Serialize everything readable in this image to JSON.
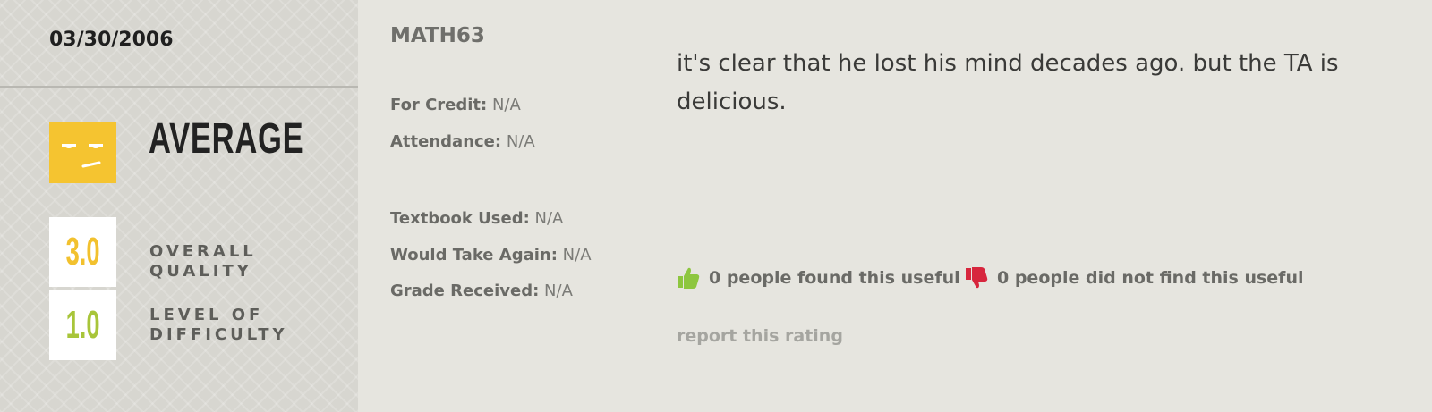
{
  "rating": {
    "date": "03/30/2006",
    "mood": "AVERAGE",
    "mood_icon": "meh-face-icon",
    "mood_color": "#f5c430",
    "scores": {
      "overall_quality": {
        "value": "3.0",
        "label": "OVERALL QUALITY",
        "color": "#f2c12e"
      },
      "level_of_difficulty": {
        "value": "1.0",
        "label": "LEVEL OF DIFFICULTY",
        "color": "#a8c53a"
      }
    }
  },
  "class_info": {
    "course": "MATH63",
    "for_credit_label": "For Credit:",
    "for_credit_value": "N/A",
    "attendance_label": "Attendance:",
    "attendance_value": "N/A",
    "textbook_label": "Textbook Used:",
    "textbook_value": "N/A",
    "take_again_label": "Would Take Again:",
    "take_again_value": "N/A",
    "grade_label": "Grade Received:",
    "grade_value": "N/A"
  },
  "comment": {
    "text": "it's clear that he lost his mind decades ago. but the TA is delicious.",
    "useful_text": "0 people found this useful",
    "not_useful_text": "0 people did not find this useful",
    "thumbs_up_color": "#8dc63f",
    "thumbs_down_color": "#d7263d",
    "report_text": "report this rating"
  }
}
